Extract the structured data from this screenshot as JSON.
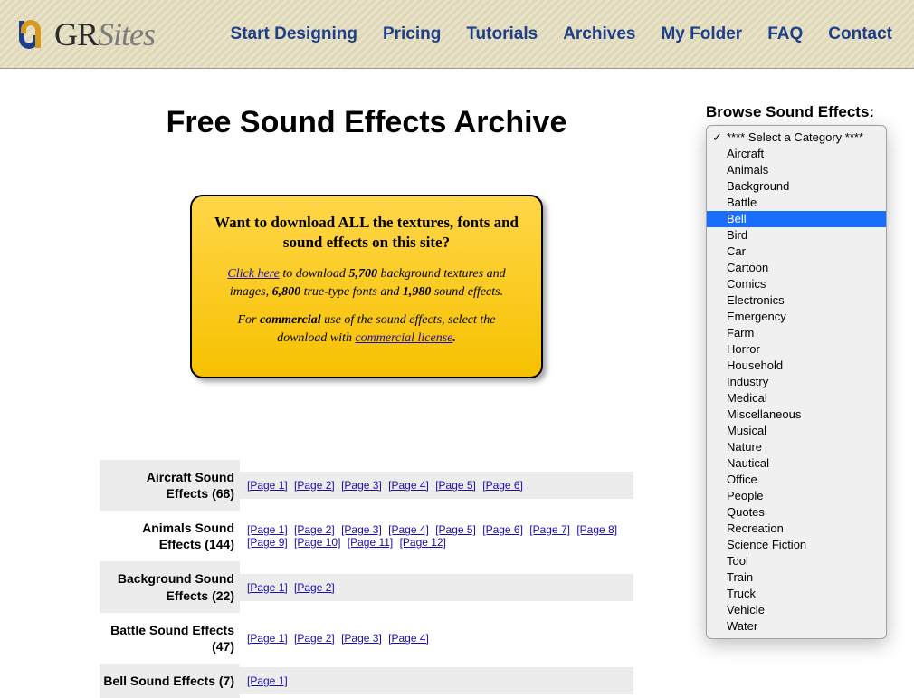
{
  "brand": {
    "g": "GR",
    "sites": "Sites"
  },
  "nav": {
    "start": "Start Designing",
    "pricing": "Pricing",
    "tutorials": "Tutorials",
    "archives": "Archives",
    "folder": "My Folder",
    "faq": "FAQ",
    "contact": "Contact"
  },
  "page_title": "Free Sound Effects Archive",
  "promo": {
    "headline": "Want to download ALL the textures, fonts and sound effects on this site?",
    "click_here": "Click here",
    "p1a": " to download ",
    "n1": "5,700",
    "p1b": " background textures and images, ",
    "n2": "6,800",
    "p1c": " true-type fonts and ",
    "n3": "1,980",
    "p1d": " sound effects.",
    "p2a": "For ",
    "commercial": "commercial",
    "p2b": " use of the sound effects, select the download with ",
    "license_link": "commercial license",
    "p2c": "."
  },
  "categories": [
    {
      "name": "Aircraft Sound Effects (68)",
      "pages": 6
    },
    {
      "name": "Animals Sound Effects (144)",
      "pages": 12
    },
    {
      "name": "Background Sound Effects (22)",
      "pages": 2
    },
    {
      "name": "Battle Sound Effects (47)",
      "pages": 4
    },
    {
      "name": "Bell Sound Effects (7)",
      "pages": 1
    }
  ],
  "browse": {
    "label": "Browse Sound Effects:",
    "checked_index": 0,
    "highlight_index": 5,
    "items": [
      "**** Select a Category ****",
      "Aircraft",
      "Animals",
      "Background",
      "Battle",
      "Bell",
      "Bird",
      "Car",
      "Cartoon",
      "Comics",
      "Electronics",
      "Emergency",
      "Farm",
      "Horror",
      "Household",
      "Industry",
      "Medical",
      "Miscellaneous",
      "Musical",
      "Nature",
      "Nautical",
      "Office",
      "People",
      "Quotes",
      "Recreation",
      "Science Fiction",
      "Tool",
      "Train",
      "Truck",
      "Vehicle",
      "Water"
    ]
  },
  "page_link_prefix": "[Page ",
  "page_link_suffix": "]"
}
